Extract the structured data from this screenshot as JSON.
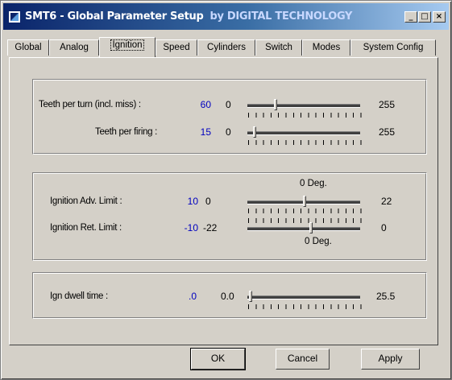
{
  "window": {
    "title": "SMT6 - Global Parameter Setup",
    "title_by": "by DIGITAL TECHNOLOGY",
    "min_label": "_",
    "max_label": "□",
    "close_label": "×"
  },
  "tabs": [
    {
      "label": "Global",
      "active": false
    },
    {
      "label": "Analog",
      "active": false
    },
    {
      "label": "Ignition",
      "active": true
    },
    {
      "label": "Speed",
      "active": false
    },
    {
      "label": "Cylinders",
      "active": false
    },
    {
      "label": "Switch",
      "active": false
    },
    {
      "label": "Modes",
      "active": false
    },
    {
      "label": "System Config",
      "active": false
    }
  ],
  "teeth": {
    "per_turn": {
      "label": "Teeth per turn (incl. miss) :",
      "value": "60",
      "min": "0",
      "max": "255"
    },
    "per_firing": {
      "label": "Teeth per firing :",
      "value": "15",
      "min": "0",
      "max": "255"
    }
  },
  "ignition": {
    "adv_limit": {
      "label": "Ignition Adv. Limit :",
      "value": "10",
      "min": "0",
      "max": "22",
      "zero_label": "0 Deg."
    },
    "ret_limit": {
      "label": "Ignition Ret. Limit :",
      "value": "-10",
      "min": "-22",
      "max": "0",
      "zero_label": "0 Deg."
    }
  },
  "dwell": {
    "label": "Ign dwell time :",
    "value": ".0",
    "min": "0.0",
    "max": "25.5"
  },
  "buttons": {
    "ok": "OK",
    "cancel": "Cancel",
    "apply": "Apply"
  },
  "colors": {
    "title_gradient_start": "#0a246a",
    "title_gradient_end": "#a6caf0",
    "value_text": "#0000c0",
    "face": "#d4d0c8"
  }
}
